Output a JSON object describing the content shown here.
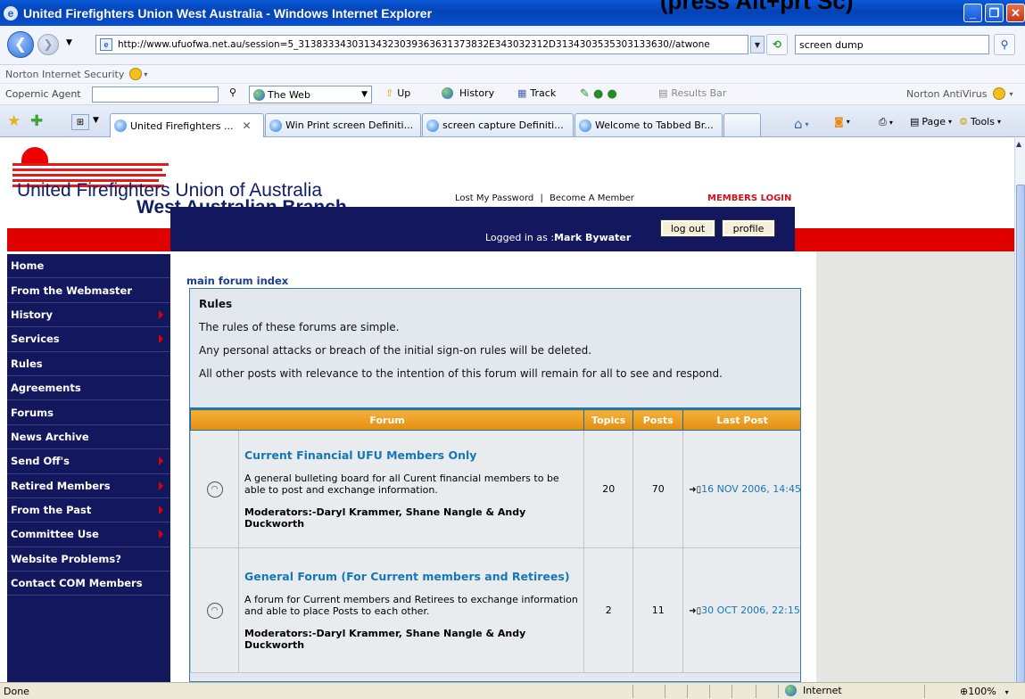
{
  "overlay_caption": "(press Alt+prt Sc)",
  "window": {
    "title": "United Firefighters Union West Australia - Windows Internet Explorer"
  },
  "address_bar": {
    "url": "http://www.ufuofwa.net.au/session=5_31383334303134323039363631373832E343032312D3134303535303133630//atwone",
    "search_value": "screen dump"
  },
  "toolbar_norton": {
    "label": "Norton Internet Security"
  },
  "toolbar_copernic": {
    "label": "Copernic Agent",
    "scope": "The Web",
    "up": "Up",
    "history": "History",
    "track": "Track",
    "results": "Results Bar",
    "antivirus": "Norton AntiVirus"
  },
  "tabs": [
    {
      "label": "United Firefighters ...",
      "active": true
    },
    {
      "label": "Win Print screen Definiti..."
    },
    {
      "label": "screen capture Definiti..."
    },
    {
      "label": "Welcome to Tabbed Br..."
    }
  ],
  "commands": {
    "page": "Page",
    "tools": "Tools"
  },
  "site": {
    "name_line1": "United Firefighters Union of Australia",
    "name_line2": "West Australian Branch",
    "lost_password": "Lost My Password",
    "become_member": "Become A Member",
    "sep": "|",
    "members_login": "MEMBERS LOGIN",
    "logged_prefix": "Logged in as :",
    "logged_user": "Mark Bywater",
    "logout": "log out",
    "profile": "profile"
  },
  "sidebar": {
    "items": [
      {
        "label": "Home"
      },
      {
        "label": "From the Webmaster"
      },
      {
        "label": "History",
        "arrow": true
      },
      {
        "label": "Services",
        "arrow": true
      },
      {
        "label": "Rules"
      },
      {
        "label": "Agreements"
      },
      {
        "label": "Forums"
      },
      {
        "label": "News Archive"
      },
      {
        "label": "Send Off's",
        "arrow": true
      },
      {
        "label": "Retired Members",
        "arrow": true
      },
      {
        "label": "From the Past",
        "arrow": true
      },
      {
        "label": "Committee Use",
        "arrow": true
      },
      {
        "label": "Website Problems?"
      },
      {
        "label": "Contact COM Members"
      }
    ]
  },
  "forum": {
    "index_link": "main forum index",
    "rules_title": "Rules",
    "rules_lines": [
      "The rules of these forums are simple.",
      "Any personal attacks or breach of the initial sign-on rules will be deleted.",
      "All other posts with relevance to the intention of this forum will remain for all to see and respond."
    ],
    "columns": {
      "forum": "Forum",
      "topics": "Topics",
      "posts": "Posts",
      "last_post": "Last Post"
    },
    "rows": [
      {
        "title": "Current Financial UFU Members Only",
        "desc": "A general bulleting board for all Curent financial members to be able to post and exchange information.",
        "mods": "Moderators:-Daryl Krammer, Shane Nangle & Andy Duckworth",
        "topics": "20",
        "posts": "70",
        "last": "16 NOV 2006, 14:45"
      },
      {
        "title": "General Forum (For Current members and Retirees)",
        "desc": "A forum for Current members and Retirees to exchange information and able to place Posts to each other.",
        "mods": "Moderators:-Daryl Krammer, Shane Nangle & Andy Duckworth",
        "topics": "2",
        "posts": "11",
        "last": "30 OCT 2006, 22:15"
      }
    ]
  },
  "status": {
    "left": "Done",
    "zone": "Internet",
    "zoom": "100%"
  }
}
